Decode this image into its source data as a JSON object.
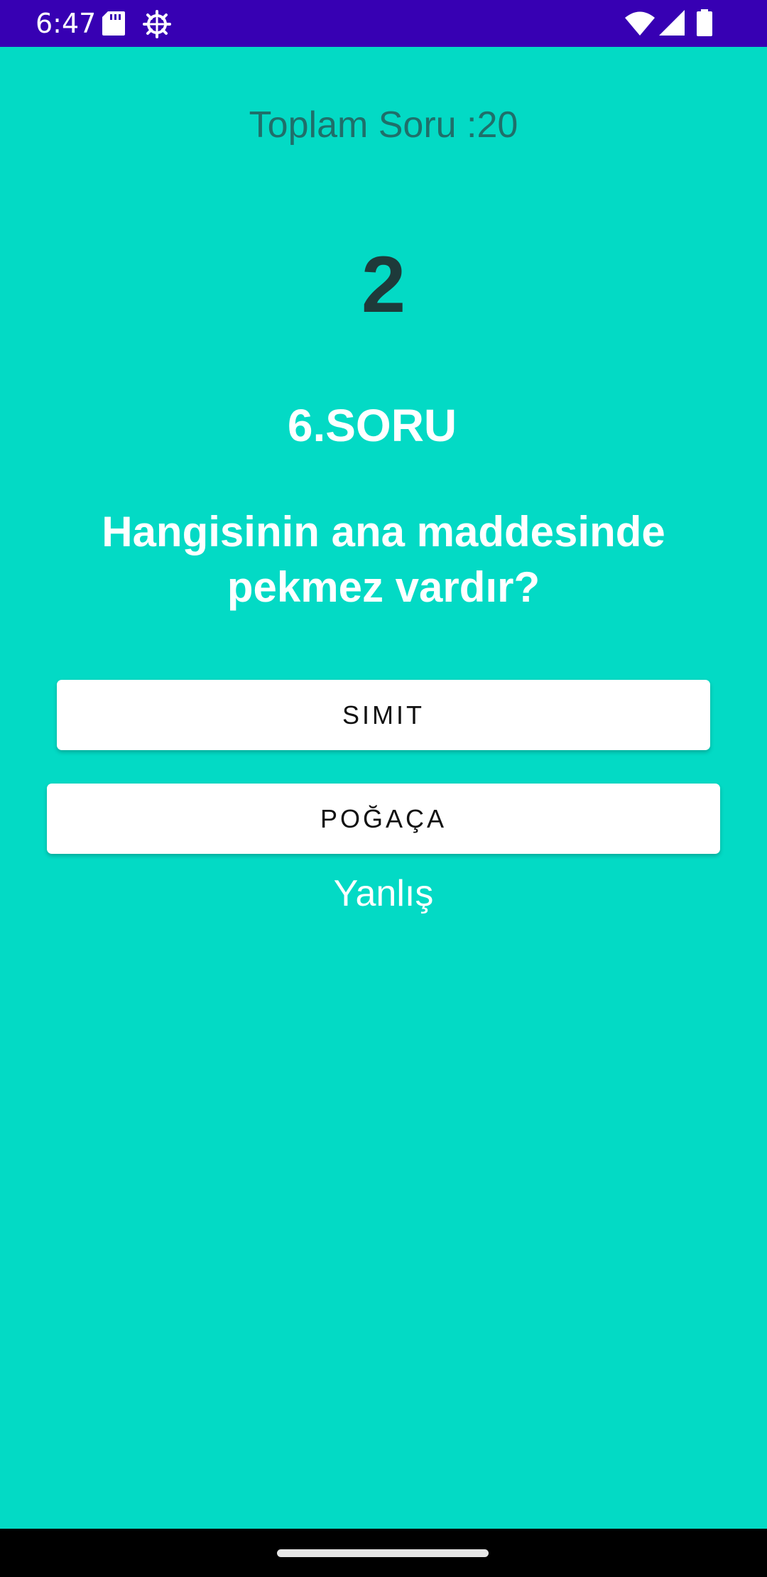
{
  "status_bar": {
    "time": "6:47",
    "icons": [
      "sd-card-icon",
      "settings-icon",
      "wifi-icon",
      "cellular-signal-icon",
      "battery-icon"
    ],
    "background_color": "#3700B3"
  },
  "quiz": {
    "total_label": "Toplam Soru :20",
    "score": "2",
    "question_number": "6.SORU",
    "question_text": "Hangisinin ana maddesinde pekmez vardır?",
    "answers": [
      {
        "label": "SIMIT"
      },
      {
        "label": "POĞAÇA"
      }
    ],
    "result_text": "Yanlış",
    "background_color": "#03DAC5"
  },
  "nav_bar": {
    "background_color": "#000000"
  }
}
